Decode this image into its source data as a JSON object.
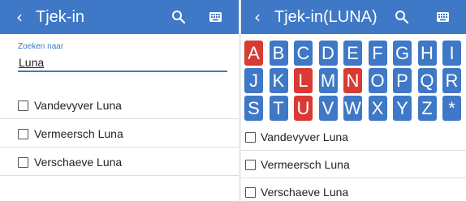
{
  "colors": {
    "accent": "#3e78c6",
    "highlight": "#d93a34",
    "text": "#222222",
    "divider": "#dddddd"
  },
  "left_screen": {
    "appbar": {
      "back_icon": "chevron-left-icon",
      "title": "Tjek-in",
      "search_icon": "search-icon",
      "keyboard_icon": "keyboard-icon"
    },
    "search": {
      "caption": "Zoeken naar",
      "value": "Luna"
    },
    "results": [
      {
        "name": "Vandevyver Luna",
        "checked": false
      },
      {
        "name": "Vermeersch Luna",
        "checked": false
      },
      {
        "name": "Verschaeve Luna",
        "checked": false
      }
    ]
  },
  "right_screen": {
    "appbar": {
      "back_icon": "chevron-left-icon",
      "title": "Tjek-in(LUNA)",
      "search_icon": "search-icon",
      "keyboard_icon": "keyboard-icon"
    },
    "keyboard": {
      "rows": [
        [
          "A",
          "B",
          "C",
          "D",
          "E",
          "F",
          "G",
          "H",
          "I"
        ],
        [
          "J",
          "K",
          "L",
          "M",
          "N",
          "O",
          "P",
          "Q",
          "R"
        ],
        [
          "S",
          "T",
          "U",
          "V",
          "W",
          "X",
          "Y",
          "Z",
          "*"
        ]
      ],
      "highlighted_keys": [
        "A",
        "L",
        "N",
        "U"
      ]
    },
    "results": [
      {
        "name": "Vandevyver Luna",
        "checked": false
      },
      {
        "name": "Vermeersch Luna",
        "checked": false
      },
      {
        "name": "Verschaeve Luna",
        "checked": false
      }
    ]
  }
}
